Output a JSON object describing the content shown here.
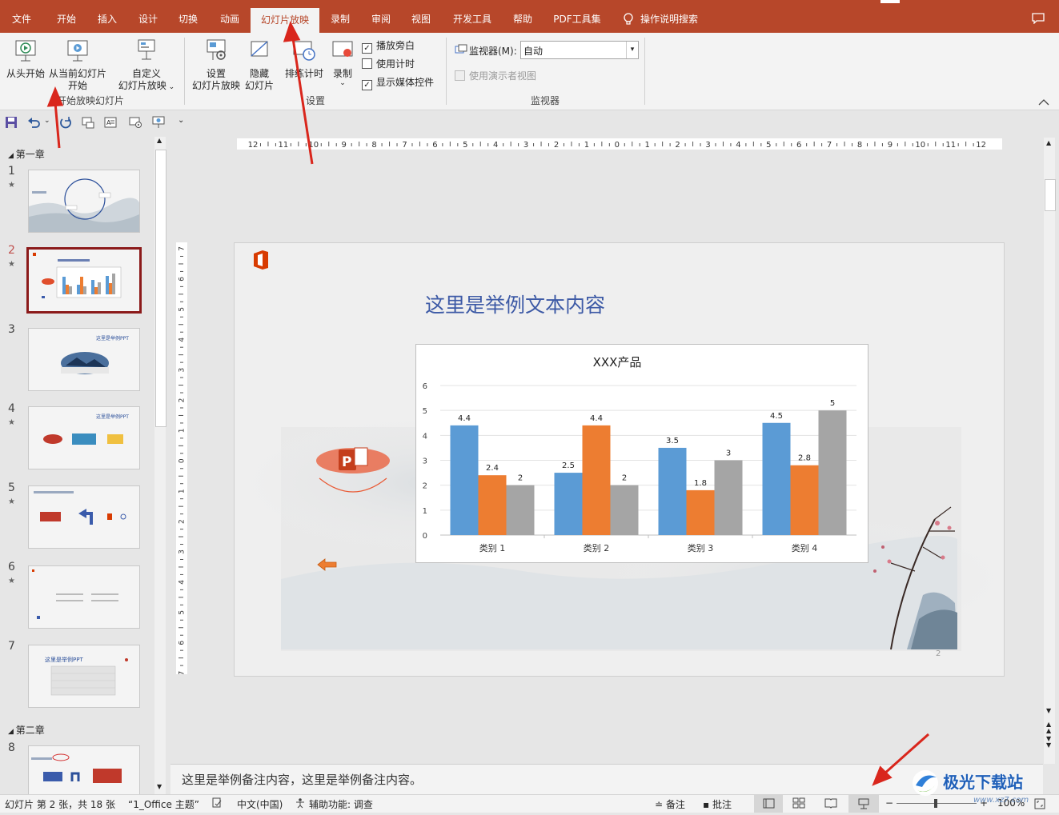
{
  "tabs": [
    "文件",
    "开始",
    "插入",
    "设计",
    "切换",
    "动画",
    "幻灯片放映",
    "录制",
    "审阅",
    "视图",
    "开发工具",
    "帮助",
    "PDF工具集",
    "操作说明搜索"
  ],
  "ribbon": {
    "start_group": {
      "from_beginning": "从头开始",
      "from_current_1": "从当前幻灯片",
      "from_current_2": "开始",
      "custom_1": "自定义",
      "custom_2": "幻灯片放映",
      "label": "开始放映幻灯片"
    },
    "setup_group": {
      "setup_1": "设置",
      "setup_2": "幻灯片放映",
      "hide_1": "隐藏",
      "hide_2": "幻灯片",
      "rehearse": "排练计时",
      "record": "录制",
      "play_narration": "播放旁白",
      "use_timings": "使用计时",
      "show_media": "显示媒体控件",
      "label": "设置"
    },
    "monitor_group": {
      "monitor_label": "监视器(M):",
      "monitor_value": "自动",
      "presenter_view": "使用演示者视图",
      "label": "监视器"
    }
  },
  "thumbnails": {
    "section1": "第一章",
    "section2": "第二章",
    "slides": [
      {
        "num": "1",
        "star": "★"
      },
      {
        "num": "2",
        "star": "★"
      },
      {
        "num": "3",
        "star": ""
      },
      {
        "num": "4",
        "star": "★"
      },
      {
        "num": "5",
        "star": "★"
      },
      {
        "num": "6",
        "star": "★"
      },
      {
        "num": "7",
        "star": ""
      },
      {
        "num": "8",
        "star": ""
      }
    ]
  },
  "ruler_h": [
    "12",
    "11",
    "10",
    "9",
    "8",
    "7",
    "6",
    "5",
    "4",
    "3",
    "2",
    "1",
    "0",
    "1",
    "2",
    "3",
    "4",
    "5",
    "6",
    "7",
    "8",
    "9",
    "10",
    "11",
    "12"
  ],
  "ruler_v": [
    "7",
    "6",
    "5",
    "4",
    "3",
    "2",
    "1",
    "0",
    "1",
    "2",
    "3",
    "4",
    "5",
    "6",
    "7"
  ],
  "slide": {
    "title": "这里是举例文本内容",
    "page_num": "2"
  },
  "chart_data": {
    "type": "bar",
    "title": "XXX产品",
    "categories": [
      "类别 1",
      "类别 2",
      "类别 3",
      "类别 4"
    ],
    "series": [
      {
        "values": [
          4.4,
          2.5,
          3.5,
          4.5
        ],
        "color": "#5b9bd5"
      },
      {
        "values": [
          2.4,
          4.4,
          1.8,
          2.8
        ],
        "color": "#ed7d31"
      },
      {
        "values": [
          2,
          2,
          3,
          5
        ],
        "color": "#a5a5a5"
      }
    ],
    "ylim": [
      0,
      6
    ],
    "yticks": [
      "0",
      "1",
      "2",
      "3",
      "4",
      "5",
      "6"
    ],
    "grid": true
  },
  "notes": "这里是举例备注内容，这里是举例备注内容。",
  "status": {
    "slide_info": "幻灯片 第 2 张，共 18 张",
    "theme": "“1_Office 主题”",
    "language": "中文(中国)",
    "accessibility": "辅助功能: 调查",
    "notes_btn": "备注",
    "comments_btn": "批注",
    "zoom": "100%"
  },
  "watermark": "极光下载站",
  "watermark_url": "www.xz7.com",
  "colors": {
    "brand": "#b7472a",
    "arrow": "#d9261c"
  }
}
